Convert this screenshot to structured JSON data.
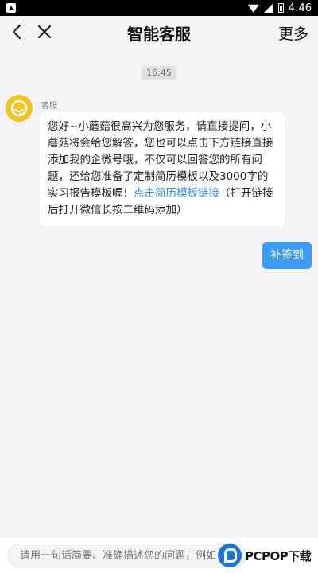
{
  "status_bar": {
    "time": "4:46"
  },
  "nav": {
    "title": "智能客服",
    "more_label": "更多"
  },
  "chat": {
    "timestamp": "16:45",
    "agent_name": "客服",
    "agent_message_text": "您好~小蘑菇很高兴为您服务，请直接提问，小蘑菇将会给您解答，您也可以点击下方链接直接添加我的企微号哦，不仅可以回答您的所有问题，还给您准备了定制简历模板以及3000字的实习报告模板喔！",
    "agent_message_link": "点击简历模板链接",
    "agent_message_suffix": "（打开链接后打开微信长按二维码添加）",
    "user_message": "补签到"
  },
  "input": {
    "placeholder": "请用一句话简要、准确描述您的问题，例如"
  },
  "watermark": {
    "text": "PCPOP下载"
  },
  "colors": {
    "accent": "#3d9df4",
    "link": "#2d8cf0",
    "avatar": "#f3c21b"
  }
}
